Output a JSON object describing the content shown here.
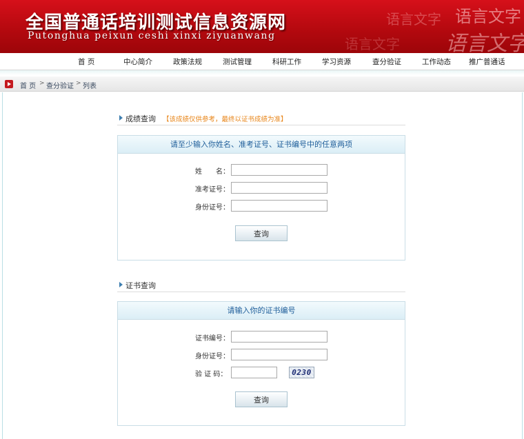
{
  "header": {
    "title": "全国普通话培训测试信息资源网",
    "subtitle": "Putonghua peixun ceshi xinxi ziyuanwang",
    "decoration": [
      "语言文字",
      "语言文字",
      "语言文字",
      "语言文字"
    ]
  },
  "nav": [
    "首 页",
    "中心简介",
    "政策法规",
    "测试管理",
    "科研工作",
    "学习资源",
    "查分验证",
    "工作动态",
    "推广普通话"
  ],
  "breadcrumb": [
    "首 页",
    "查分验证",
    "列表"
  ],
  "score_query": {
    "section_title": "成绩查询",
    "note": "【该成绩仅供参考，最终以证书成绩为准】",
    "panel_title": "请至少输入你姓名、准考证号、证书编号中的任意两项",
    "name_label": "姓　　名：",
    "exam_no_label": "准考证号：",
    "id_no_label": "身份证号：",
    "name_value": "",
    "exam_no_value": "",
    "id_no_value": "",
    "submit_label": "查询"
  },
  "cert_query": {
    "section_title": "证书查询",
    "panel_title": "请输入你的证书编号",
    "cert_no_label": "证书编号：",
    "id_no_label": "身份证号：",
    "captcha_label": "验 证 码：",
    "cert_no_value": "",
    "id_no_value": "",
    "captcha_value": "",
    "captcha_image_text": "0230",
    "submit_label": "查询"
  },
  "colors": {
    "header_red": "#c8101a",
    "note_orange": "#e8871c",
    "panel_title_blue": "#1f5e9a"
  }
}
